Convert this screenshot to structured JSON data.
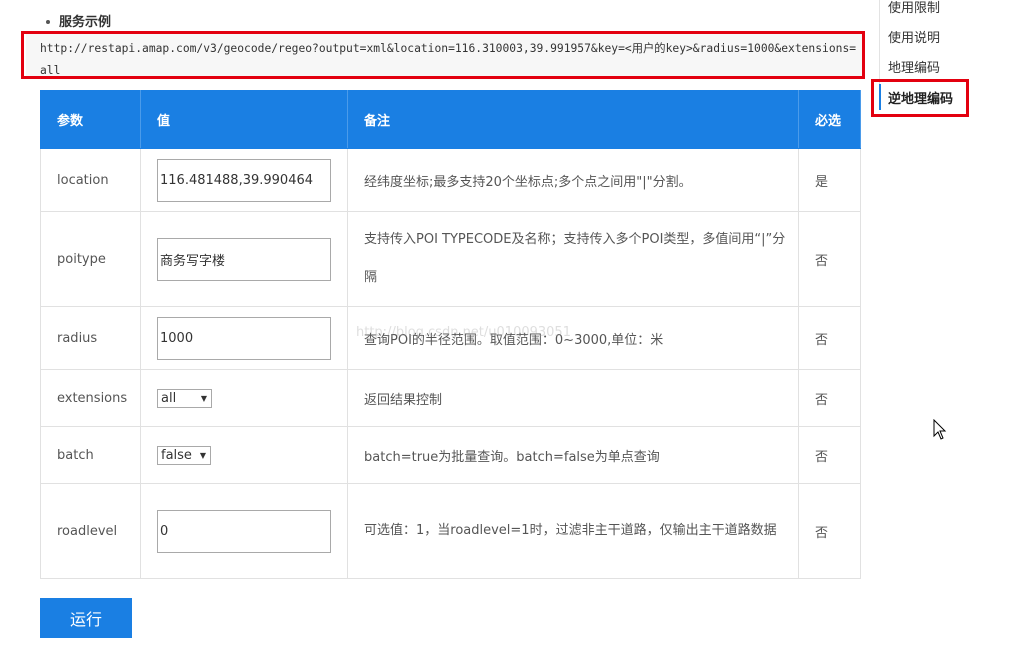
{
  "section": {
    "title": "服务示例"
  },
  "example": {
    "url": "http://restapi.amap.com/v3/geocode/regeo?output=xml&location=116.310003,39.991957&key=<用户的key>&radius=1000&extensions=all"
  },
  "table": {
    "headers": [
      "参数",
      "值",
      "备注",
      "必选"
    ],
    "rows": [
      {
        "param": "location",
        "value": "116.481488,39.990464",
        "note": "经纬度坐标;最多支持20个坐标点;多个点之间用\"|\"分割。",
        "required": "是"
      },
      {
        "param": "poitype",
        "value": "商务写字楼",
        "note": "支持传入POI TYPECODE及名称；支持传入多个POI类型，多值间用“|”分隔",
        "required": "否"
      },
      {
        "param": "radius",
        "value": "1000",
        "note": "查询POI的半径范围。取值范围：0~3000,单位：米",
        "required": "否"
      },
      {
        "param": "extensions",
        "value": "all",
        "note": "返回结果控制",
        "required": "否"
      },
      {
        "param": "batch",
        "value": "false",
        "note": "batch=true为批量查询。batch=false为单点查询",
        "required": "否"
      },
      {
        "param": "roadlevel",
        "value": "0",
        "note": "可选值：1，当roadlevel=1时，过滤非主干道路，仅输出主干道路数据",
        "required": "否"
      }
    ]
  },
  "run_button": {
    "label": "运行"
  },
  "sidebar": {
    "items": [
      {
        "label": "使用限制",
        "active": false
      },
      {
        "label": "使用说明",
        "active": false
      },
      {
        "label": "地理编码",
        "active": false
      },
      {
        "label": "逆地理编码",
        "active": true
      }
    ]
  },
  "watermark": {
    "text": "http://blog.csdn.net/u010093051"
  },
  "colors": {
    "accent": "#1a7fe3",
    "highlight": "#e3000f"
  }
}
